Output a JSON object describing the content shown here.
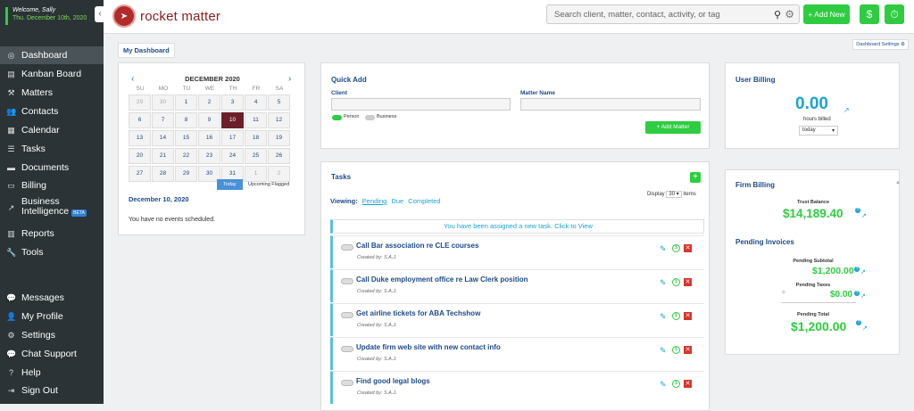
{
  "user": {
    "welcome": "Welcome, Sally",
    "date": "Thu. December 10th, 2020"
  },
  "sidebar": {
    "items": [
      {
        "label": "Dashboard",
        "icon": "dashboard-icon",
        "glyph": "◎"
      },
      {
        "label": "Kanban Board",
        "icon": "kanban-icon",
        "glyph": "▤"
      },
      {
        "label": "Matters",
        "icon": "gavel-icon",
        "glyph": "⚒"
      },
      {
        "label": "Contacts",
        "icon": "contacts-icon",
        "glyph": "👥"
      },
      {
        "label": "Calendar",
        "icon": "calendar-icon",
        "glyph": "▦"
      },
      {
        "label": "Tasks",
        "icon": "tasks-icon",
        "glyph": "☰"
      },
      {
        "label": "Documents",
        "icon": "folder-icon",
        "glyph": "▬"
      },
      {
        "label": "Billing",
        "icon": "billing-icon",
        "glyph": "▭"
      },
      {
        "label": "Business",
        "label2": "Intelligence",
        "badge": "BETA",
        "icon": "chart-icon",
        "glyph": "↗"
      },
      {
        "label": "Reports",
        "icon": "reports-icon",
        "glyph": "▥"
      },
      {
        "label": "Tools",
        "icon": "wrench-icon",
        "glyph": "🔧"
      }
    ],
    "bottom": [
      {
        "label": "Messages",
        "icon": "chat-icon",
        "glyph": "💬"
      },
      {
        "label": "My Profile",
        "icon": "user-icon",
        "glyph": "👤"
      },
      {
        "label": "Settings",
        "icon": "gear-icon",
        "glyph": "⚙"
      },
      {
        "label": "Chat Support",
        "icon": "support-chat-icon",
        "glyph": "💬"
      },
      {
        "label": "Help",
        "icon": "help-icon",
        "glyph": "?"
      },
      {
        "label": "Sign Out",
        "icon": "signout-icon",
        "glyph": "⇥"
      }
    ]
  },
  "header": {
    "brand": "rocket matter",
    "search_placeholder": "Search client, matter, contact, activity, or tag",
    "add_new": "+ Add New"
  },
  "dashboard": {
    "tab": "My Dashboard",
    "settings": "Dashboard Settings ⚙"
  },
  "calendar": {
    "month": "DECEMBER 2020",
    "dow": [
      "SU",
      "MO",
      "TU",
      "WE",
      "TH",
      "FR",
      "SA"
    ],
    "days": [
      [
        "29",
        "30",
        "1",
        "2",
        "3",
        "4",
        "5"
      ],
      [
        "6",
        "7",
        "8",
        "9",
        "10",
        "11",
        "12"
      ],
      [
        "13",
        "14",
        "15",
        "16",
        "17",
        "18",
        "19"
      ],
      [
        "20",
        "21",
        "22",
        "23",
        "24",
        "25",
        "26"
      ],
      [
        "27",
        "28",
        "29",
        "30",
        "31",
        "1",
        "2"
      ]
    ],
    "today_btn": "Today",
    "upcoming_btn": "Upcoming Flagged",
    "selected_date": "December 10, 2020",
    "no_events": "You have no events scheduled."
  },
  "quick_add": {
    "title": "Quick Add",
    "client_label": "Client",
    "matter_label": "Matter Name",
    "person": "Person",
    "business": "Business",
    "button": "+ Add Matter"
  },
  "tasks": {
    "title": "Tasks",
    "viewing": "Viewing:",
    "filters": [
      "Pending",
      "Due",
      "Completed"
    ],
    "display": "Display",
    "display_val": "30",
    "items_label": "items",
    "assigned_notice": "You have been assigned a new task. Click to View",
    "list": [
      {
        "name": "Call Bar association re CLE courses",
        "by": "Created by: S.A.J."
      },
      {
        "name": "Call Duke employment office re Law Clerk position",
        "by": "Created by: S.A.J."
      },
      {
        "name": "Get airline tickets for ABA Techshow",
        "by": "Created by: S.A.J."
      },
      {
        "name": "Update firm web site with new contact info",
        "by": "Created by: S.A.J."
      },
      {
        "name": "Find good legal blogs",
        "by": "Created by: S.A.J."
      }
    ]
  },
  "user_billing": {
    "title": "User Billing",
    "value": "0.00",
    "label": "hours billed",
    "period": "today"
  },
  "firm_billing": {
    "title": "Firm Billing",
    "trust_label": "Trust Balance",
    "trust_value": "$14,189.40",
    "pending_title": "Pending Invoices",
    "subtotal_label": "Pending Subtotal",
    "subtotal_value": "$1,200.00",
    "taxes_label": "Pending Taxes",
    "taxes_value": "$0.00",
    "total_label": "Pending Total",
    "total_value": "$1,200.00"
  },
  "colors": {
    "accent": "#2ecc40",
    "sidebar": "#2b3336",
    "link": "#1aa3d4",
    "brand": "#8a1f22"
  }
}
